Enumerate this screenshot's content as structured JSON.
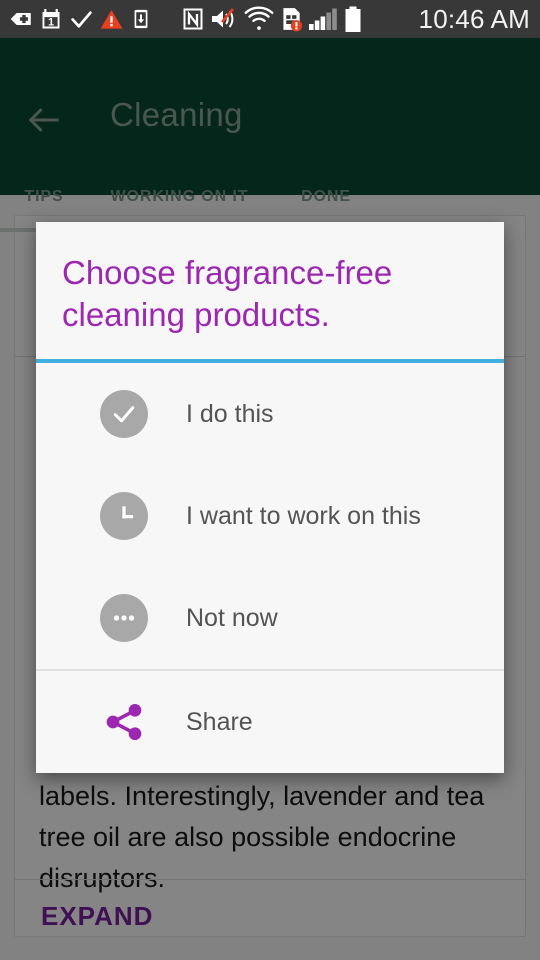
{
  "statusbar": {
    "time": "10:46 AM",
    "icons": [
      "shield-plus-icon",
      "calendar-1-icon",
      "checkmark-icon",
      "warning-triangle-icon",
      "phone-download-icon",
      "nfc-icon",
      "volume-mute-icon",
      "wifi-icon",
      "sim-card-alert-icon",
      "cell-signal-icon",
      "battery-full-icon"
    ],
    "background_color": "#383838",
    "warning_color": "#e8401f"
  },
  "appbar": {
    "back_label": "back-arrow",
    "title": "Cleaning",
    "background_color": "#0b4a33",
    "tabs": [
      {
        "label": "TIPS",
        "selected": true
      },
      {
        "label": "WORKING ON IT",
        "selected": false
      },
      {
        "label": "DONE",
        "selected": false
      }
    ]
  },
  "background_page": {
    "body_text": "labels. Interestingly, lavender and tea tree oil are also possible endocrine disruptors.",
    "expand_label": "EXPAND",
    "expand_color": "#7b1fa2"
  },
  "dialog": {
    "title": "Choose fragrance-free cleaning products.",
    "title_color": "#9c27b0",
    "accent_divider_color": "#41b0de",
    "surface_color": "#f7f7f7",
    "options": [
      {
        "label": "I do this",
        "icon": "check-circle-icon"
      },
      {
        "label": "I want to work on this",
        "icon": "clock-circle-icon"
      },
      {
        "label": "Not now",
        "icon": "more-horizontal-circle-icon"
      }
    ],
    "share": {
      "label": "Share",
      "icon": "share-icon",
      "icon_color": "#9c27b0"
    }
  }
}
